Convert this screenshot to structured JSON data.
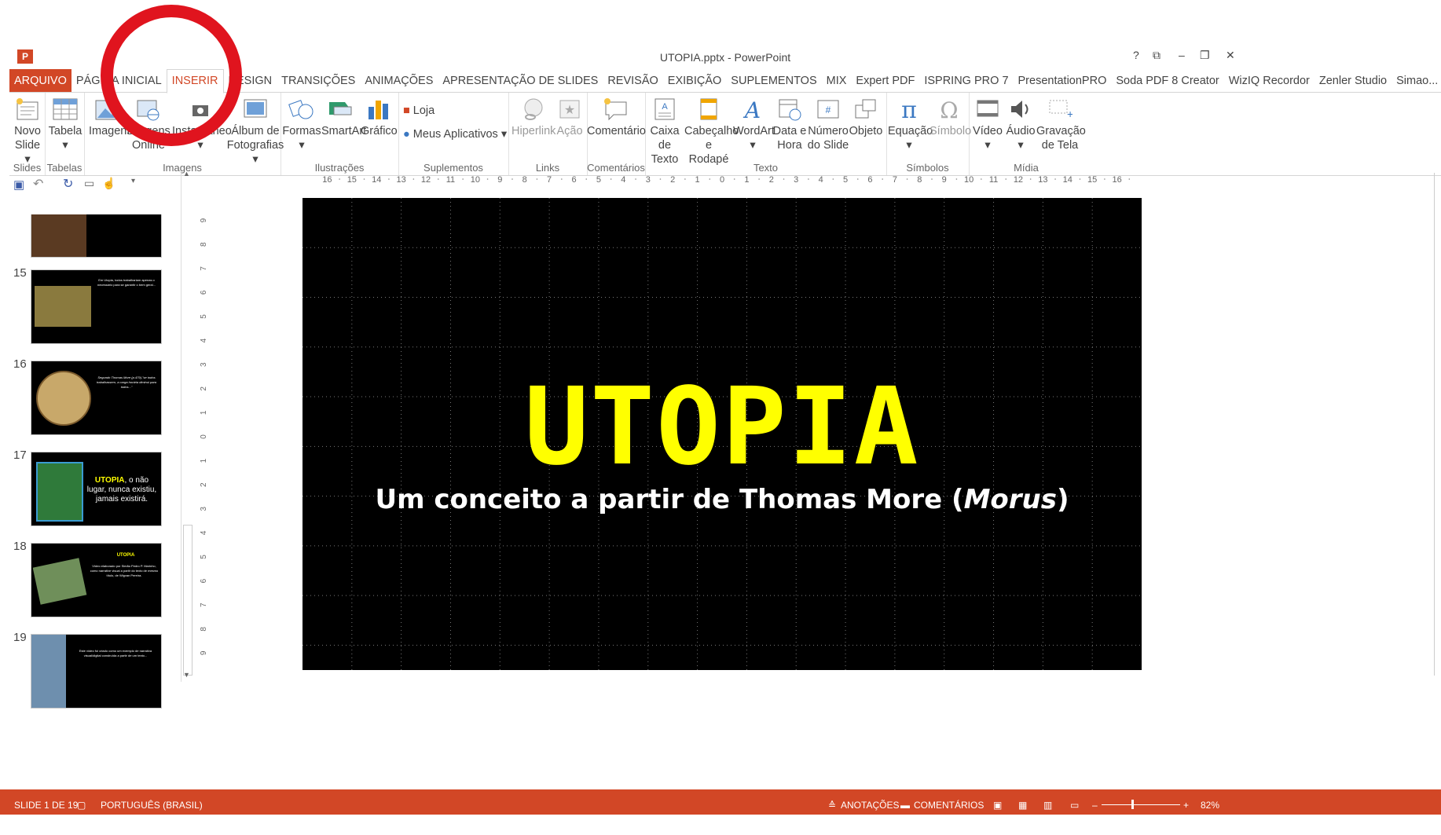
{
  "window": {
    "title": "UTOPIA.pptx - PowerPoint",
    "controls": [
      "?",
      "⧉",
      "–",
      "❐",
      "✕"
    ]
  },
  "tabs": [
    {
      "label": "ARQUIVO"
    },
    {
      "label": "PÁGINA INICIAL"
    },
    {
      "label": "INSERIR"
    },
    {
      "label": "DESIGN"
    },
    {
      "label": "TRANSIÇÕES"
    },
    {
      "label": "ANIMAÇÕES"
    },
    {
      "label": "APRESENTAÇÃO DE SLIDES"
    },
    {
      "label": "REVISÃO"
    },
    {
      "label": "EXIBIÇÃO"
    },
    {
      "label": "SUPLEMENTOS"
    },
    {
      "label": "MIX"
    },
    {
      "label": "Expert PDF"
    },
    {
      "label": "ISPRING PRO 7"
    },
    {
      "label": "PresentationPRO"
    },
    {
      "label": "Soda PDF 8 Creator"
    },
    {
      "label": "WizIQ Recordor"
    },
    {
      "label": "Zenler Studio"
    },
    {
      "label": "Simao..."
    }
  ],
  "ribbon": {
    "groups": {
      "slides": "Slides",
      "tabelas": "Tabelas",
      "imagens": "Imagens",
      "ilustracoes": "Ilustrações",
      "suplementos": "Suplementos",
      "links": "Links",
      "comentarios": "Comentários",
      "texto": "Texto",
      "simbolos": "Símbolos",
      "midia": "Mídia"
    },
    "buttons": {
      "novo_slide": [
        "Novo",
        "Slide ▾"
      ],
      "tabela": [
        "Tabela",
        "▾"
      ],
      "imagens": [
        "Imagens"
      ],
      "imagens_online": [
        "Imagens",
        "Online"
      ],
      "instantaneo": [
        "Instantâneo",
        "▾"
      ],
      "album": [
        "Álbum de",
        "Fotografias ▾"
      ],
      "formas": [
        "Formas",
        "▾"
      ],
      "smartart": [
        "SmartArt"
      ],
      "grafico": [
        "Gráfico"
      ],
      "loja": "Loja",
      "meus_aplicativos": "Meus Aplicativos ▾",
      "hiperlink": [
        "Hiperlink"
      ],
      "acao": [
        "Ação"
      ],
      "comentario": [
        "Comentário"
      ],
      "caixa_texto": [
        "Caixa",
        "de Texto"
      ],
      "cabecalho": [
        "Cabeçalho",
        "e Rodapé"
      ],
      "wordart": [
        "WordArt",
        "▾"
      ],
      "data_hora": [
        "Data e",
        "Hora"
      ],
      "numero_slide": [
        "Número",
        "do Slide"
      ],
      "objeto": [
        "Objeto"
      ],
      "equacao": [
        "Equação",
        "▾"
      ],
      "simbolo": [
        "Símbolo"
      ],
      "video": [
        "Vídeo",
        "▾"
      ],
      "audio": [
        "Áudio",
        "▾"
      ],
      "gravacao": [
        "Gravação",
        "de Tela"
      ]
    }
  },
  "thumbnails": [
    {
      "number": "15",
      "text": "Em Utopia, todos trabalhariam apenas o necessário para se garantir o bem geral..."
    },
    {
      "number": "16",
      "text": "Segundo Thomas More (p.479),\"se todos trabalhassem, a carga horária diminui para todos...\""
    },
    {
      "number": "17",
      "text_highlight": "UTOPIA",
      "text": ", o não lugar, nunca existiu, jamais existirá."
    },
    {
      "number": "18",
      "text_highlight": "UTOPIA",
      "text": "Vídeo elaborado por Simão Pedro P. Marinho, como narrative visual a partir do texto de mesmo título, de Wigvan Pereira."
    },
    {
      "number": "19",
      "text": "Este vídeo foi criado como um exemplo de narrativa visual/digital construída a partir de um texto..."
    }
  ],
  "slide": {
    "title": "UTOPIA",
    "subtitle_prefix": "Um conceito a partir de Thomas More (",
    "subtitle_italic": "Morus",
    "subtitle_suffix": ")"
  },
  "ruler": {
    "labels": [
      "16",
      "15",
      "14",
      "13",
      "12",
      "11",
      "10",
      "9",
      "8",
      "7",
      "6",
      "5",
      "4",
      "3",
      "2",
      "1",
      "0",
      "1",
      "2",
      "3",
      "4",
      "5",
      "6",
      "7",
      "8",
      "9",
      "10",
      "11",
      "12",
      "13",
      "14",
      "15",
      "16"
    ]
  },
  "status": {
    "slide": "SLIDE 1 DE 19",
    "language": "PORTUGUÊS (BRASIL)",
    "notes": "ANOTAÇÕES",
    "comments": "COMENTÁRIOS",
    "zoom": "82%"
  },
  "colors": {
    "accent": "#d24726",
    "slide_title": "#ffff00",
    "annotation_circle": "#e0141e"
  }
}
